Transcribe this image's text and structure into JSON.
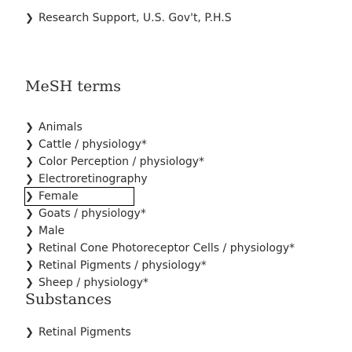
{
  "clipped_top_text": "...",
  "publication_type": "Research Support, U.S. Gov't, P.H.S",
  "mesh": {
    "heading": "MeSH terms",
    "terms": [
      "Animals",
      "Cattle / physiology*",
      "Color Perception / physiology*",
      "Electroretinography",
      "Female",
      "Goats / physiology*",
      "Male",
      "Retinal Cone Photoreceptor Cells / physiology*",
      "Retinal Pigments / physiology*",
      "Sheep / physiology*"
    ],
    "focused_index": 4
  },
  "substances": {
    "heading": "Substances",
    "terms": [
      "Retinal Pigments"
    ]
  },
  "icons": {
    "expand": "chevron-right-icon"
  }
}
